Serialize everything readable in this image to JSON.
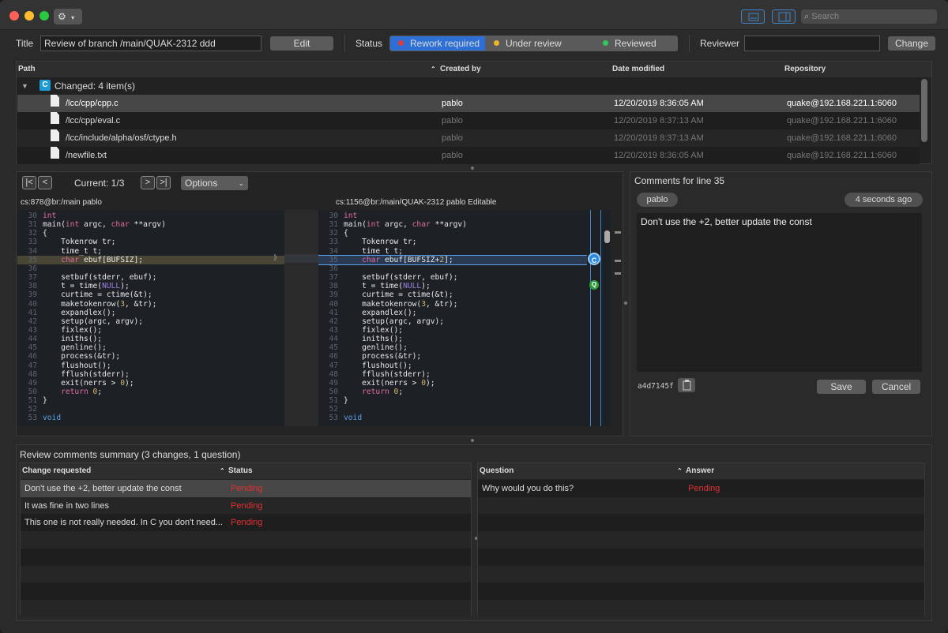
{
  "window": {
    "search_placeholder": "Search"
  },
  "header": {
    "title_label": "Title",
    "title_value": "Review of branch /main/QUAK-2312 ddd",
    "edit_label": "Edit",
    "status_label": "Status",
    "status_options": [
      {
        "label": "Rework required",
        "color": "#e03a3a",
        "selected": true
      },
      {
        "label": "Under review",
        "color": "#f0b429",
        "selected": false
      },
      {
        "label": "Reviewed",
        "color": "#34c759",
        "selected": false
      }
    ],
    "reviewer_label": "Reviewer",
    "reviewer_value": "",
    "change_label": "Change"
  },
  "files": {
    "columns": [
      "Path",
      "Created by",
      "Date modified",
      "Repository"
    ],
    "group_label": "Changed: 4 item(s)",
    "group_icon": "C",
    "rows": [
      {
        "path": "/lcc/cpp/cpp.c",
        "created_by": "pablo",
        "date": "12/20/2019 8:36:05 AM",
        "repo": "quake@192.168.221.1:6060"
      },
      {
        "path": "/lcc/cpp/eval.c",
        "created_by": "pablo",
        "date": "12/20/2019 8:37:13 AM",
        "repo": "quake@192.168.221.1:6060"
      },
      {
        "path": "/lcc/include/alpha/osf/ctype.h",
        "created_by": "pablo",
        "date": "12/20/2019 8:37:13 AM",
        "repo": "quake@192.168.221.1:6060"
      },
      {
        "path": "/newfile.txt",
        "created_by": "pablo",
        "date": "12/20/2019 8:36:05 AM",
        "repo": "quake@192.168.221.1:6060"
      }
    ]
  },
  "diff": {
    "current": "Current: 1/3",
    "options_label": "Options",
    "left_header": "cs:878@br:/main pablo",
    "right_header": "cs:1156@br:/main/QUAK-2312 pablo Editable",
    "line_numbers": [
      "30",
      "31",
      "32",
      "33",
      "34",
      "35",
      "36",
      "37",
      "38",
      "39",
      "40",
      "41",
      "42",
      "43",
      "44",
      "45",
      "46",
      "47",
      "48",
      "49",
      "50",
      "51",
      "52",
      "53"
    ],
    "comment_marker": "C",
    "question_marker": "Q"
  },
  "comments": {
    "heading": "Comments for line 35",
    "author": "pablo",
    "time": "4 seconds ago",
    "text": "Don't use the +2, better update the const",
    "changeset": "a4d7145f",
    "save_label": "Save",
    "cancel_label": "Cancel"
  },
  "summary": {
    "heading": "Review comments summary (3 changes, 1 question)",
    "changes_columns": [
      "Change requested",
      "Status"
    ],
    "changes": [
      {
        "text": "Don't use the +2, better update the const",
        "status": "Pending"
      },
      {
        "text": "It was fine in two lines",
        "status": "Pending"
      },
      {
        "text": "This one is not really needed. In C you don't need...",
        "status": "Pending"
      }
    ],
    "questions_columns": [
      "Question",
      "Answer"
    ],
    "questions": [
      {
        "text": "Why would you do this?",
        "answer": "Pending"
      }
    ]
  }
}
